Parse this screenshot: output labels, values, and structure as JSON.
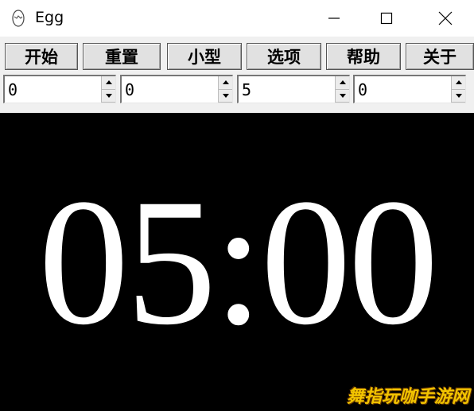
{
  "window": {
    "title": "Egg",
    "icon": "egg-icon",
    "controls": [
      "minimize-icon",
      "maximize-icon",
      "close-icon"
    ]
  },
  "toolbar": {
    "buttons": [
      "开始",
      "重置",
      "小型",
      "选项",
      "帮助",
      "关于"
    ]
  },
  "spinners": [
    "0",
    "0",
    "5",
    "0"
  ],
  "display": {
    "time": "05:00",
    "background": "#000000",
    "color": "#ffffff"
  },
  "watermark": "舞指玩咖手游网"
}
